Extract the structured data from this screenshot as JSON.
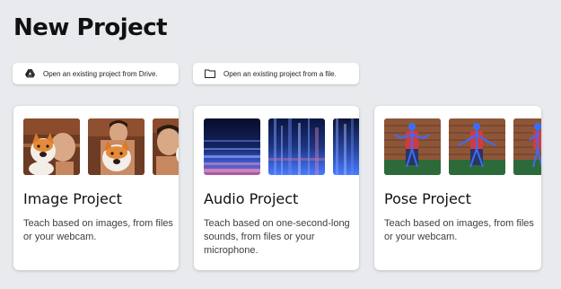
{
  "page": {
    "title": "New Project"
  },
  "open_actions": {
    "drive": {
      "label": "Open an existing project from Drive.",
      "icon": "google-drive-icon"
    },
    "file": {
      "label": "Open an existing project from a file.",
      "icon": "folder-icon"
    }
  },
  "projects": [
    {
      "id": "image",
      "title": "Image Project",
      "description": "Teach based on images, from files or your webcam.",
      "thumbnails": [
        "person-with-plush-dog-photo",
        "person-with-plush-dog-photo",
        "person-with-plush-dog-photo"
      ]
    },
    {
      "id": "audio",
      "title": "Audio Project",
      "description": "Teach based on one-second-long sounds, from files or your microphone.",
      "thumbnails": [
        "spectrogram",
        "spectrogram",
        "spectrogram"
      ]
    },
    {
      "id": "pose",
      "title": "Pose Project",
      "description": "Teach based on images, from files or your webcam.",
      "thumbnails": [
        "pose-skeleton-photo",
        "pose-skeleton-photo",
        "pose-skeleton-photo"
      ]
    }
  ],
  "colors": {
    "background": "#e8eaed",
    "card": "#ffffff",
    "text": "#202124",
    "spectrogram_dark": "#0b1438",
    "spectrogram_bright": "#4a7bff",
    "pose_skeleton": "#3b6cff"
  }
}
